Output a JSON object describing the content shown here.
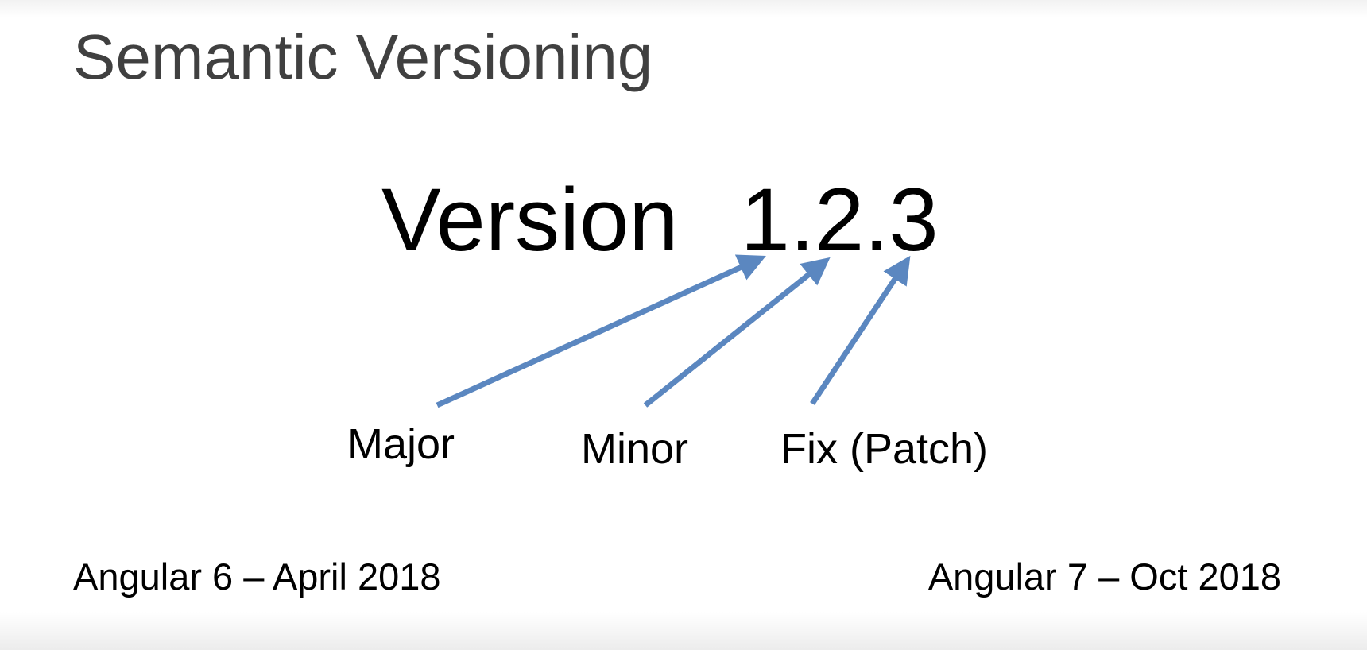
{
  "slide": {
    "title": "Semantic Versioning",
    "version": {
      "word": "Version",
      "number": "1.2.3"
    },
    "parts": [
      {
        "label": "Major"
      },
      {
        "label": "Minor"
      },
      {
        "label": "Fix (Patch)"
      }
    ],
    "footer_left": "Angular 6 – April 2018",
    "footer_right": "Angular 7 – Oct 2018"
  },
  "colors": {
    "arrow": "#5b87c0",
    "title": "#404040",
    "rule": "#9a9a9a"
  }
}
